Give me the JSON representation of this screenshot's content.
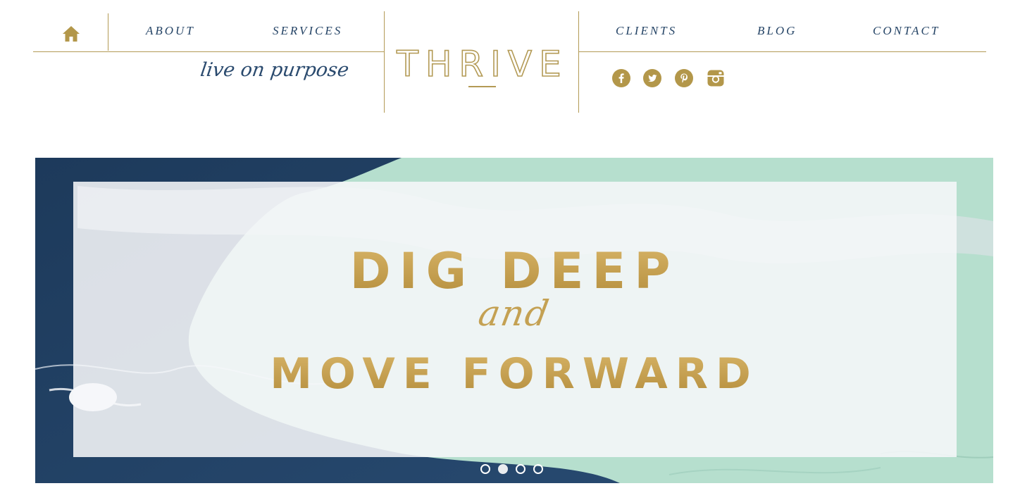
{
  "header": {
    "home_icon": "home-icon",
    "nav_left": [
      {
        "label": "ABOUT"
      },
      {
        "label": "SERVICES"
      }
    ],
    "nav_right": [
      {
        "label": "CLIENTS"
      },
      {
        "label": "BLOG"
      },
      {
        "label": "CONTACT"
      }
    ],
    "tagline": "live on purpose",
    "logo_text": "THRIVE",
    "social_icons": [
      "facebook-icon",
      "twitter-icon",
      "pinterest-icon",
      "instagram-icon"
    ]
  },
  "hero": {
    "headline_line1": "DIG DEEP",
    "headline_connector": "and",
    "headline_line2": "MOVE FORWARD",
    "slides": 4,
    "active_slide": 2
  },
  "colors": {
    "gold": "#b39a55",
    "navy": "#254466",
    "mint": "#b7e0cf"
  }
}
